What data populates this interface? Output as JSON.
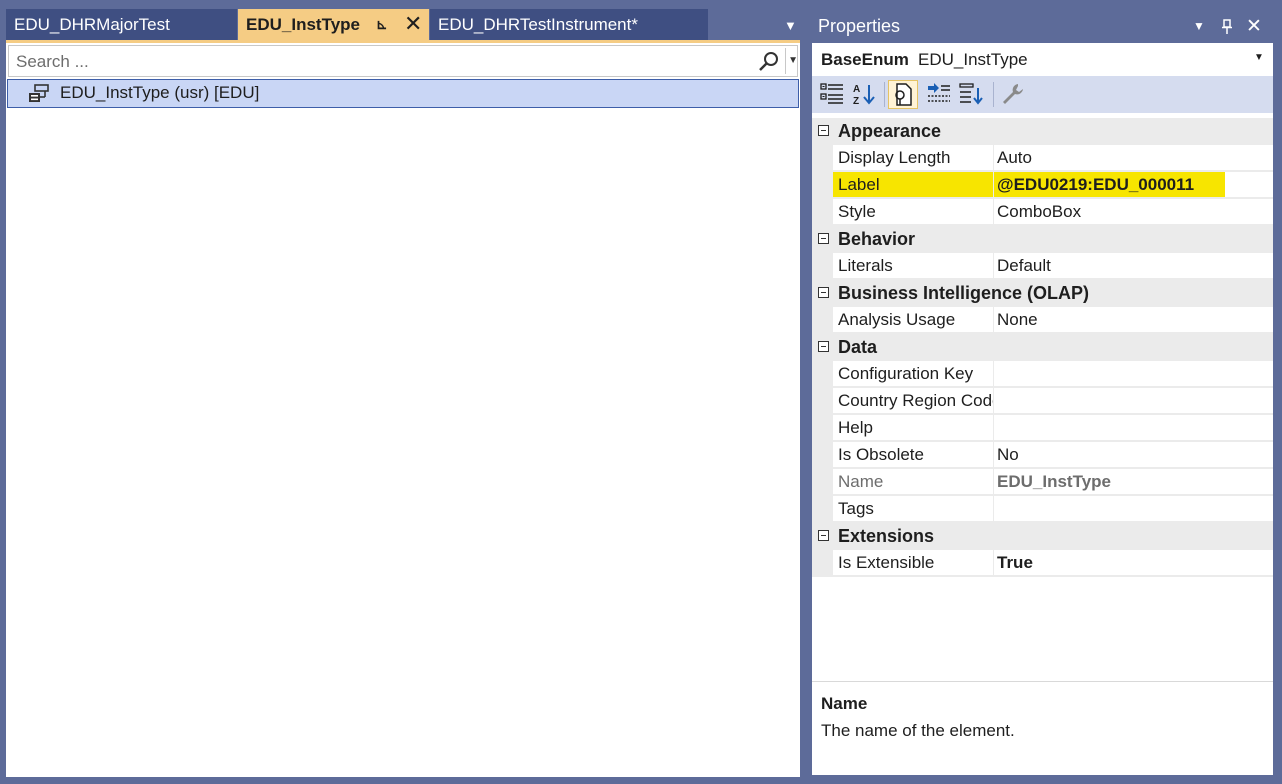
{
  "tabs": [
    {
      "label": "EDU_DHRMajorTest"
    },
    {
      "label": "EDU_InstType"
    },
    {
      "label": "EDU_DHRTestInstrument*"
    }
  ],
  "search": {
    "placeholder": "Search ..."
  },
  "tree": {
    "item_label": "EDU_InstType (usr) [EDU]"
  },
  "properties": {
    "title": "Properties",
    "object_type": "BaseEnum",
    "object_name": "EDU_InstType",
    "categories": [
      {
        "name": "Appearance",
        "props": [
          {
            "name": "Display Length",
            "value": "Auto"
          },
          {
            "name": "Label",
            "value": "@EDU0219:EDU_000011"
          },
          {
            "name": "Style",
            "value": "ComboBox"
          }
        ]
      },
      {
        "name": "Behavior",
        "props": [
          {
            "name": "Literals",
            "value": "Default"
          }
        ]
      },
      {
        "name": "Business Intelligence (OLAP)",
        "props": [
          {
            "name": "Analysis Usage",
            "value": "None"
          }
        ]
      },
      {
        "name": "Data",
        "props": [
          {
            "name": "Configuration Key",
            "value": ""
          },
          {
            "name": "Country Region Codes",
            "value": ""
          },
          {
            "name": "Help",
            "value": ""
          },
          {
            "name": "Is Obsolete",
            "value": "No"
          },
          {
            "name": "Name",
            "value": "EDU_InstType"
          },
          {
            "name": "Tags",
            "value": ""
          }
        ]
      },
      {
        "name": "Extensions",
        "props": [
          {
            "name": "Is Extensible",
            "value": "True"
          }
        ]
      }
    ],
    "description": {
      "title": "Name",
      "text": "The name of the element."
    }
  },
  "colors": {
    "highlight": "#f7e500",
    "active_tab": "#f5cc84",
    "chrome": "#5d6b99"
  }
}
